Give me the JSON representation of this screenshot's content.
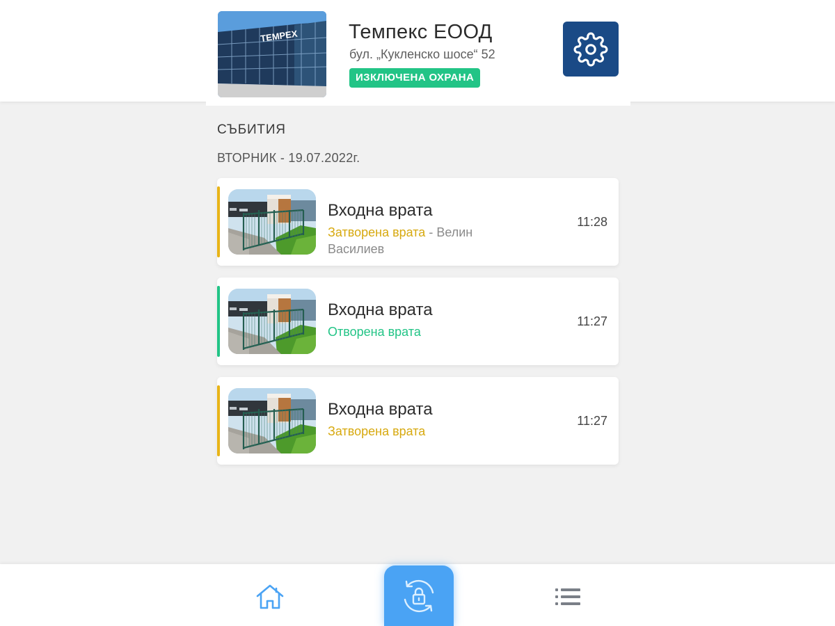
{
  "header": {
    "site_name": "Темпекс ЕООД",
    "address": "бул. „Кукленско шосе“ 52",
    "status": "ИЗКЛЮЧЕНА ОХРАНА",
    "photo_logo_text": "TEMPEX",
    "settings_icon": "gear-icon"
  },
  "events": {
    "section_title": "СЪБИТИЯ",
    "date_label": "ВТОРНИК - 19.07.2022г.",
    "items": [
      {
        "title": "Входна врата",
        "status": "Затворена врата",
        "separator": " - ",
        "user": "Велин Василиев",
        "time": "11:28",
        "accent_color": "#e8b418",
        "status_color": "#d7a90f"
      },
      {
        "title": "Входна врата",
        "status": "Отворена врата",
        "time": "11:27",
        "accent_color": "#22c486",
        "status_color": "#22c486"
      },
      {
        "title": "Входна врата",
        "status": "Затворена врата",
        "time": "11:27",
        "accent_color": "#e8b418",
        "status_color": "#d7a90f"
      }
    ]
  },
  "nav": {
    "home_icon": "home-icon",
    "arm_icon": "lock-cycle-icon",
    "list_icon": "list-icon",
    "active_color": "#4aa3f4"
  },
  "colors": {
    "brand_dark": "#1a4a86",
    "badge_green": "#22c486",
    "background": "#f1f1f1"
  }
}
